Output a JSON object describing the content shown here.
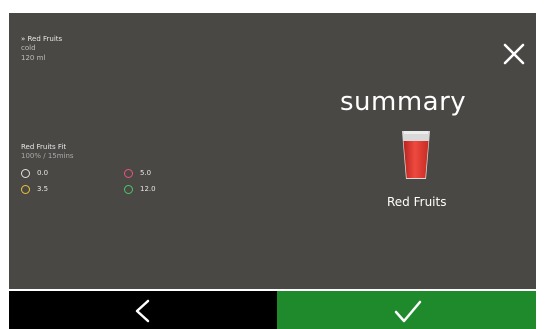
{
  "drink": {
    "name": "» Red Fruits",
    "temperature": "cold",
    "volume": "120 ml"
  },
  "recipe": {
    "name": "Red Fruits Fit",
    "ratio": "100%  /  15mins",
    "params": [
      {
        "value": "0.0",
        "color": "#e0e0e0"
      },
      {
        "value": "5.0",
        "color": "#e8537a"
      },
      {
        "value": "3.5",
        "color": "#e8c43a"
      },
      {
        "value": "12.0",
        "color": "#4fc36a"
      }
    ]
  },
  "summary": {
    "title": "summary",
    "product": "Red Fruits",
    "cup_color": "#d9322a"
  },
  "icons": {
    "close": "close-icon",
    "back": "chevron-left-icon",
    "confirm": "checkmark-icon"
  },
  "colors": {
    "background": "#4a4845",
    "back_button": "#000000",
    "confirm_button": "#1e8a2c"
  }
}
